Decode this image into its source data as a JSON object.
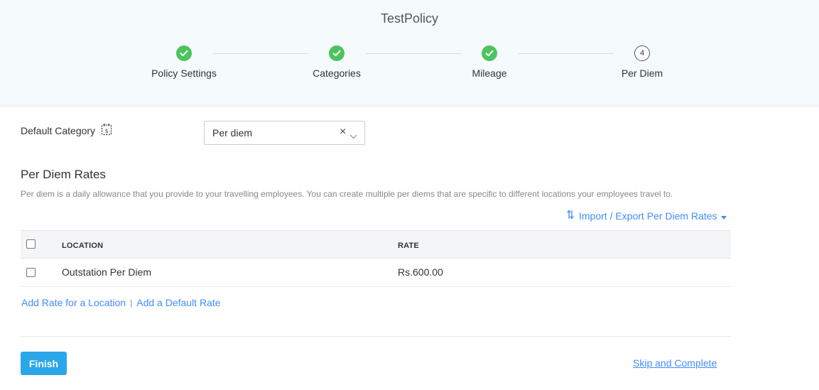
{
  "header": {
    "title": "TestPolicy",
    "steps": [
      {
        "label": "Policy Settings",
        "status": "completed"
      },
      {
        "label": "Categories",
        "status": "completed"
      },
      {
        "label": "Mileage",
        "status": "completed"
      },
      {
        "label": "Per Diem",
        "status": "current",
        "number": "4"
      }
    ]
  },
  "default_category": {
    "label": "Default Category",
    "icon": "calendar-dollar-icon",
    "value": "Per diem"
  },
  "per_diem": {
    "title": "Per Diem Rates",
    "description": "Per diem is a daily allowance that you provide to your travelling employees. You can create multiple per diems that are specific to different locations your employees travel to.",
    "import_export_label": "Import / Export Per Diem Rates"
  },
  "table": {
    "columns": [
      "LOCATION",
      "RATE"
    ],
    "rows": [
      {
        "location": "Outstation Per Diem",
        "rate": "Rs.600.00",
        "checked": false
      }
    ]
  },
  "actions": {
    "add_rate_location": "Add Rate for a Location",
    "separator": "|",
    "add_default_rate": "Add a Default Rate",
    "finish": "Finish",
    "skip": "Skip and Complete"
  },
  "colors": {
    "accent": "#408dfb",
    "step_done": "#4cc45e",
    "primary_button": "#2aa7e8",
    "header_bg": "#f5fafd"
  }
}
